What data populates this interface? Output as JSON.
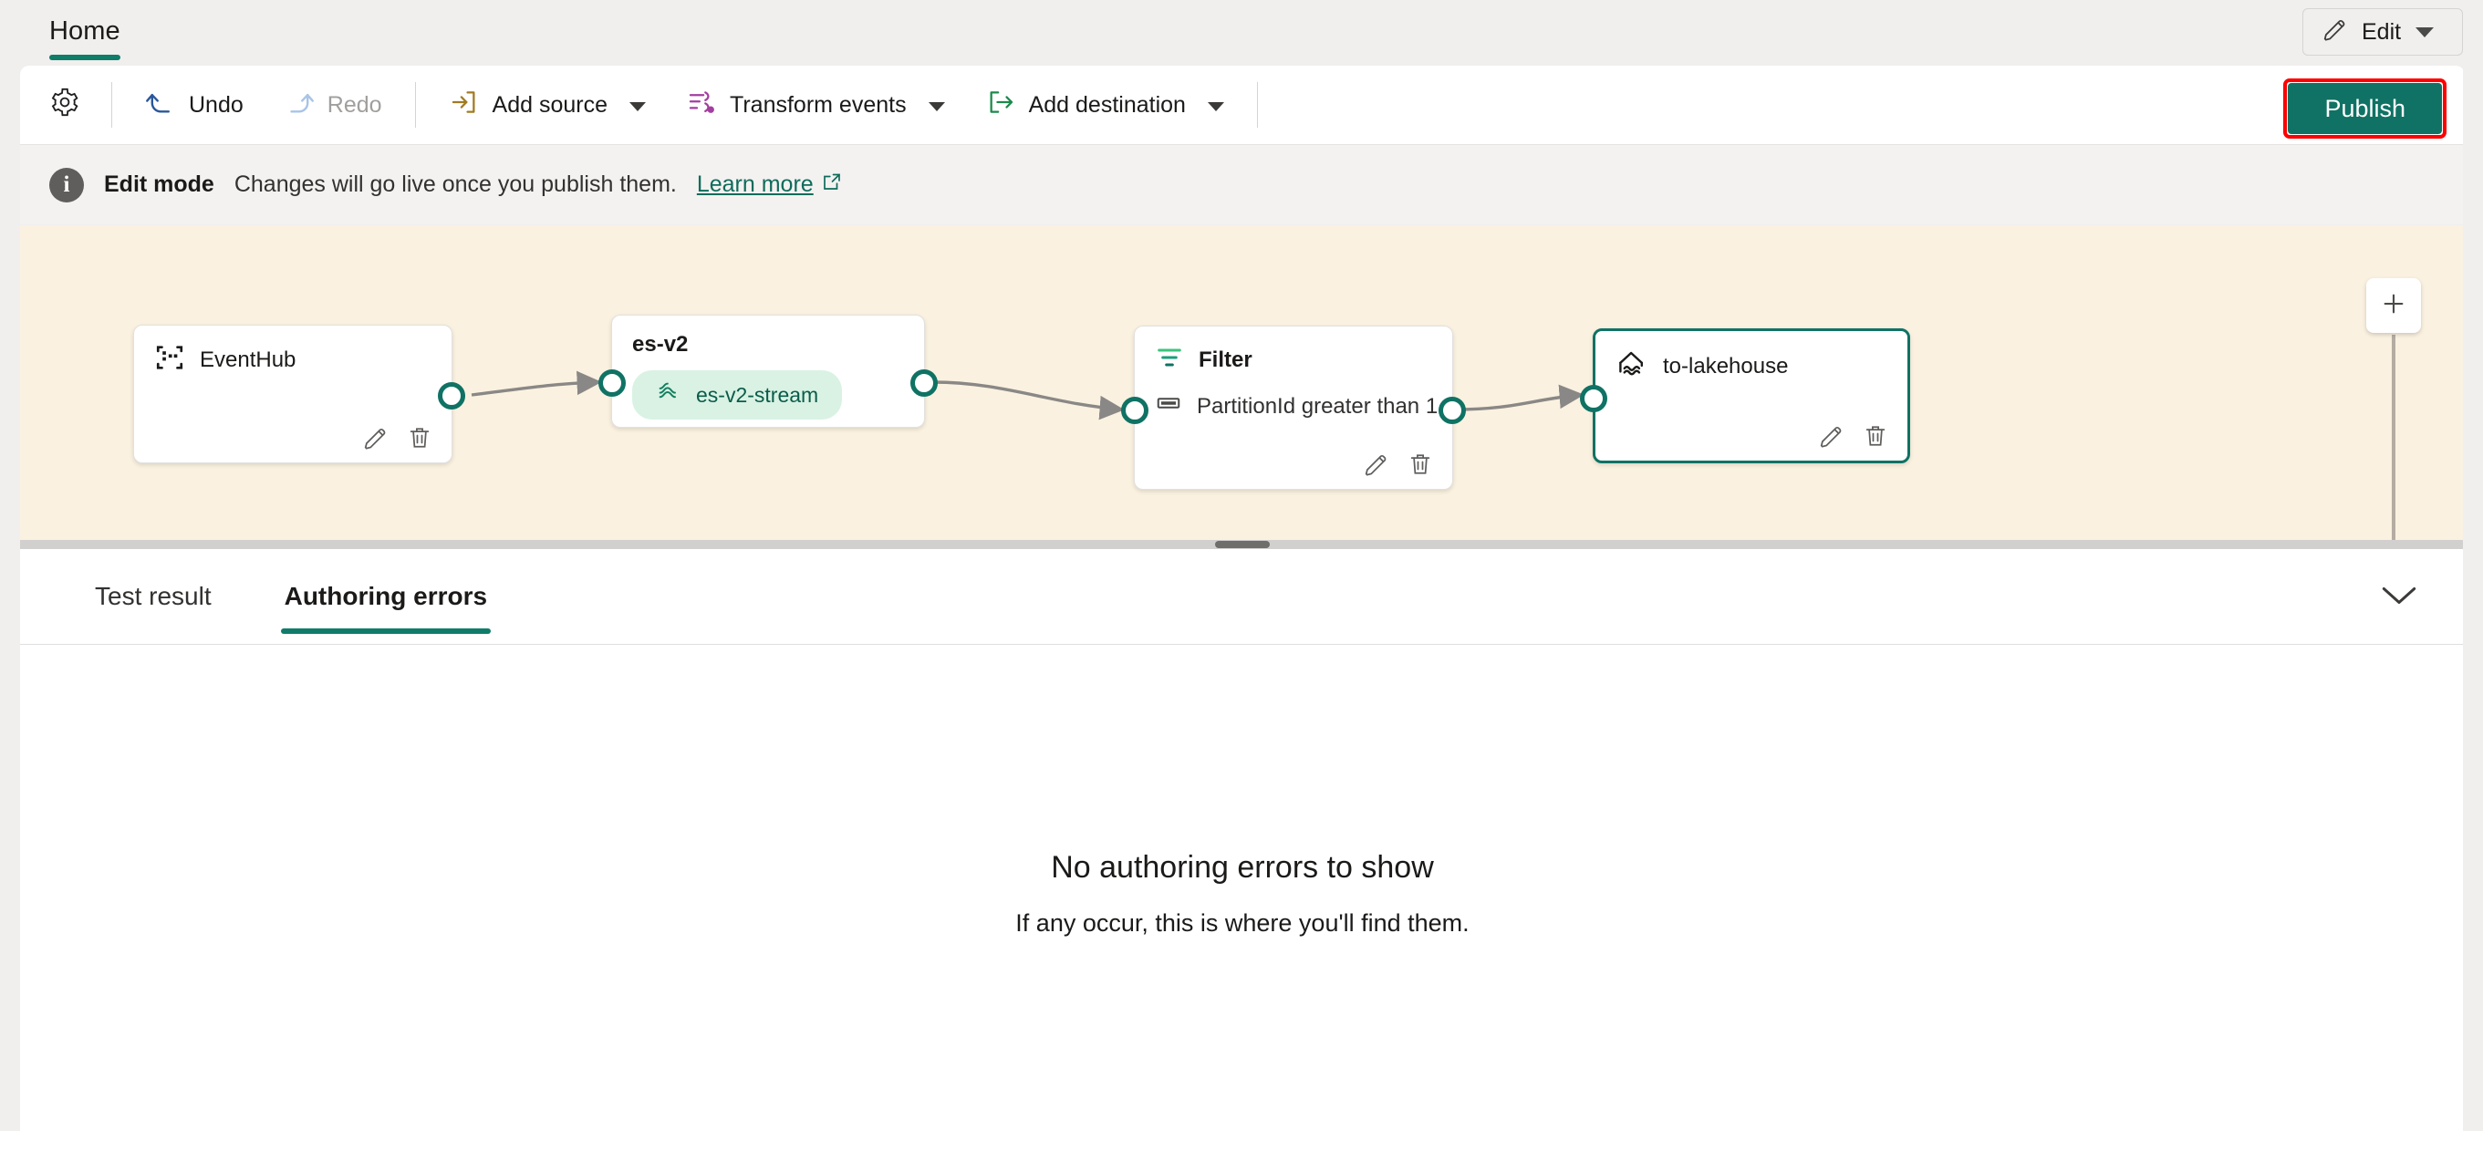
{
  "ribbon": {
    "tabs": [
      {
        "label": "Home",
        "active": true
      }
    ],
    "edit_button": {
      "label": "Edit",
      "icon": "pencil-icon",
      "caret": "chevron-down-icon"
    }
  },
  "command_bar": {
    "settings": {
      "icon": "gear-icon",
      "label": ""
    },
    "undo": {
      "label": "Undo",
      "icon": "undo-arrow-icon",
      "enabled": true
    },
    "redo": {
      "label": "Redo",
      "icon": "redo-arrow-icon",
      "enabled": false
    },
    "add_source": {
      "label": "Add source",
      "icon": "add-source-icon",
      "has_menu": true
    },
    "transform_events": {
      "label": "Transform events",
      "icon": "transform-events-icon",
      "has_menu": true
    },
    "add_destination": {
      "label": "Add destination",
      "icon": "add-destination-icon",
      "has_menu": true
    },
    "publish": {
      "label": "Publish",
      "highlight_color": "#ff0000",
      "background": "#0f7264",
      "text_color": "#ffffff"
    }
  },
  "info_bar": {
    "icon": "info-icon",
    "glyph": "i",
    "title": "Edit mode",
    "message": "Changes will go live once you publish them.",
    "link": "Learn more",
    "link_icon": "external-link-icon",
    "link_color": "#0f6b5a"
  },
  "canvas": {
    "background": "#faf1e0",
    "add_button": {
      "icon": "plus-icon",
      "label": ""
    },
    "nodes": [
      {
        "id": "eventhub",
        "title": "EventHub",
        "icon": "eventhub-icon",
        "selected": false,
        "actions": [
          "pencil-icon",
          "trash-icon"
        ]
      },
      {
        "id": "es-v2",
        "title": "es-v2",
        "icon": "",
        "selected": false,
        "pill": {
          "label": "es-v2-stream",
          "icon": "stream-icon",
          "background": "#d9f2e4",
          "text_color": "#0b5c4a"
        },
        "actions": []
      },
      {
        "id": "filter",
        "title": "Filter",
        "icon": "filter-icon",
        "selected": false,
        "subtitle": "PartitionId greater than 1",
        "subtitle_icon": "condition-icon",
        "actions": [
          "pencil-icon",
          "trash-icon"
        ]
      },
      {
        "id": "to-lakehouse",
        "title": "to-lakehouse",
        "icon": "lakehouse-icon",
        "selected": true,
        "border_color": "#0f7264",
        "actions": [
          "pencil-icon",
          "trash-icon"
        ]
      }
    ],
    "connections": [
      {
        "from": "eventhub",
        "to": "es-v2"
      },
      {
        "from": "es-v2",
        "to": "filter"
      },
      {
        "from": "filter",
        "to": "to-lakehouse"
      }
    ],
    "port_color": "#0f7264",
    "connector_color": "#8a8886"
  },
  "splitter": {
    "grip": "drag-handle"
  },
  "bottom_panel": {
    "tabs": [
      {
        "label": "Test result",
        "active": false
      },
      {
        "label": "Authoring errors",
        "active": true
      }
    ],
    "collapse": {
      "icon": "chevron-down-icon"
    },
    "empty_state": {
      "title": "No authoring errors to show",
      "subtitle": "If any occur, this is where you'll find them."
    }
  }
}
